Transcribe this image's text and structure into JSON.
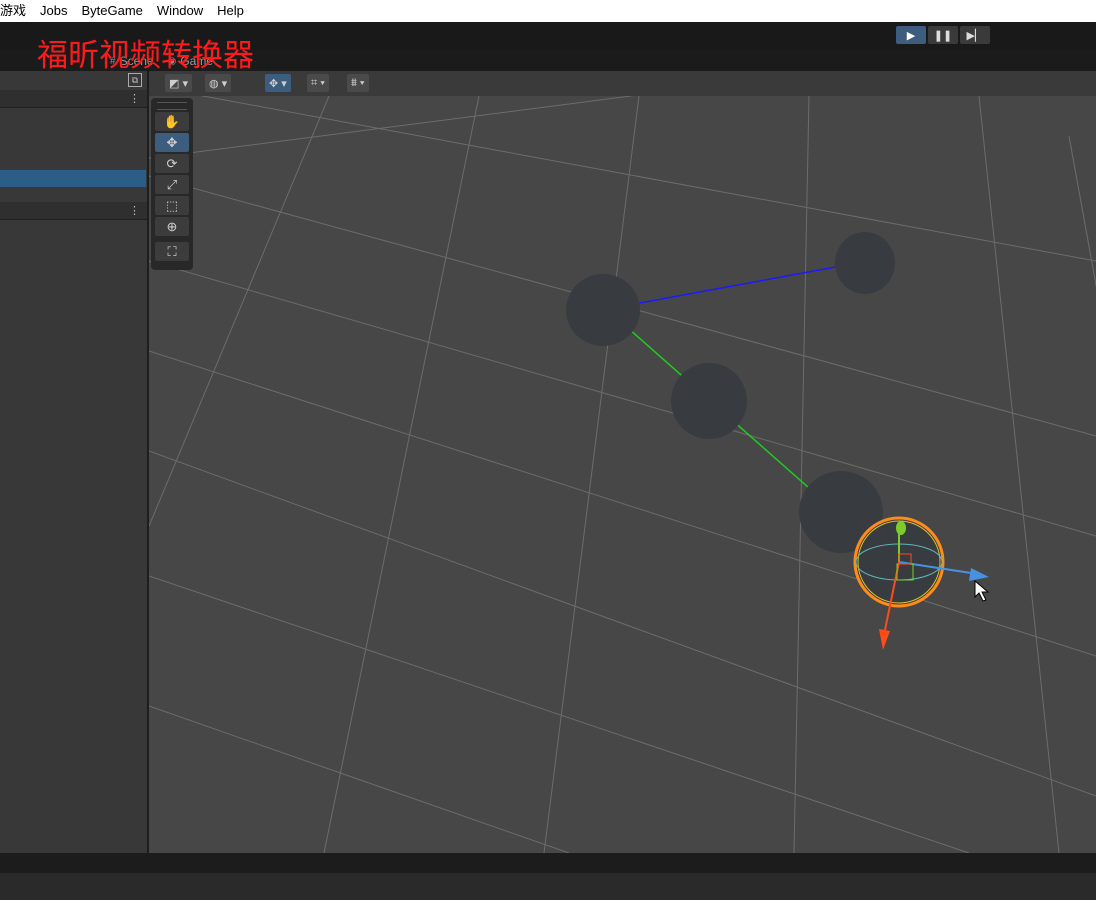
{
  "menu": {
    "items": [
      "游戏",
      "Jobs",
      "ByteGame",
      "Window",
      "Help"
    ]
  },
  "watermark": "福昕视频转换器",
  "play_controls": {
    "play_icon": "▶",
    "pause_icon": "❚❚",
    "step_icon": "▶▏"
  },
  "tabs": [
    {
      "label": "Scene",
      "icon": "#"
    },
    {
      "label": "Game",
      "icon": "◉"
    }
  ],
  "scene_toolbar": {
    "shading_icon": "◩ ▾",
    "globe_icon": "◍ ▾",
    "move_snap_icon": "✥ ▾",
    "grid_icon": "⌗ ▾",
    "ruler_icon": "⩩ ▾"
  },
  "left_panel": {
    "kebab": "⋮",
    "maximize_icon": "⧉"
  },
  "tools": {
    "hand": "✋",
    "move": "✥",
    "rotate": "⟳",
    "scale": "⤢",
    "rect": "⬚",
    "transform": "⊕",
    "custom": "⛶"
  },
  "colors": {
    "selection_blue": "#2c5d87",
    "watermark_red": "#ff1a1a",
    "link_blue": "#1a1aff",
    "link_green": "#1fcc1f",
    "gizmo_orange": "#ff8c1a"
  }
}
